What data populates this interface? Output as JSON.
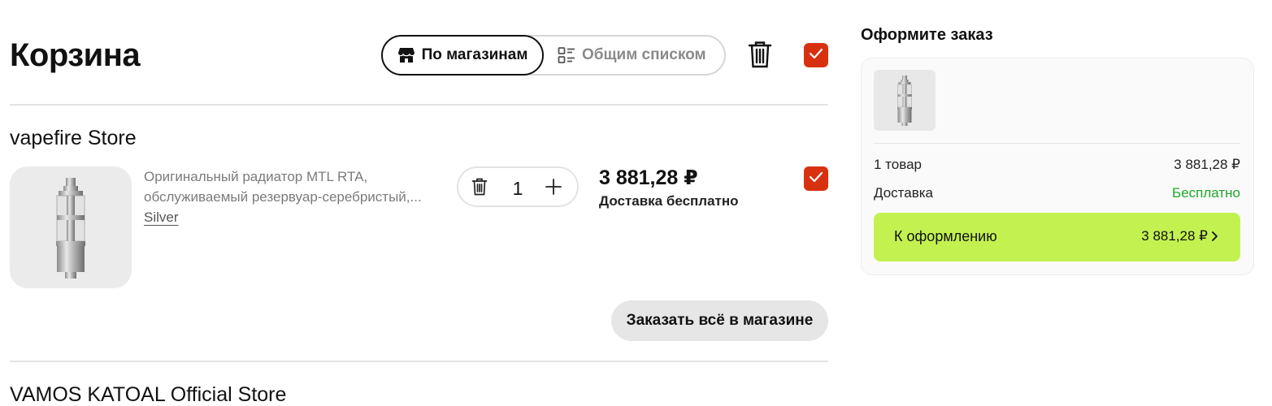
{
  "cart": {
    "title": "Корзина",
    "view_toggle": {
      "by_store_label": "По магазинам",
      "common_list_label": "Общим списком",
      "active": "by_store"
    },
    "stores": [
      {
        "name": "vapefire Store",
        "items": [
          {
            "description_line1": "Оригинальный радиатор MTL RTA,",
            "description_line2": "обслуживаемый резервуар-серебристый,...",
            "variant": "Silver",
            "quantity": "1",
            "price": "3 881,28 ₽",
            "delivery": "Доставка бесплатно",
            "selected": true
          }
        ],
        "order_all_button": "Заказать всё в магазине"
      },
      {
        "name": "VAMOS KATOAL Official Store"
      }
    ]
  },
  "summary": {
    "title": "Оформите заказ",
    "items_label": "1 товар",
    "items_total": "3 881,28 ₽",
    "delivery_label": "Доставка",
    "delivery_value": "Бесплатно",
    "checkout_label": "К оформлению",
    "checkout_total": "3 881,28 ₽"
  },
  "colors": {
    "accent_red": "#d8310f",
    "checkout_green": "#c3f250",
    "free_green": "#1ea82a"
  },
  "icons": [
    "store-icon",
    "list-icon",
    "trash-icon",
    "check-icon",
    "plus-icon",
    "chevron-right-icon"
  ]
}
